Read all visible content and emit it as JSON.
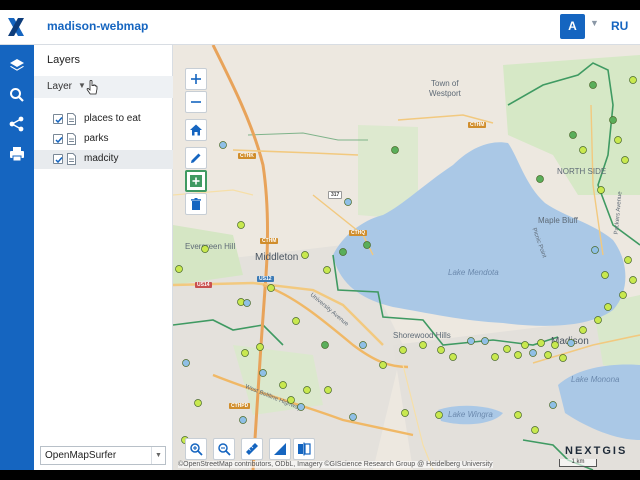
{
  "app": {
    "title": "madison-webmap",
    "user_initial": "A",
    "language": "RU"
  },
  "rail": {
    "icons": [
      "layers-icon",
      "search-icon",
      "share-icon",
      "print-icon"
    ]
  },
  "panel": {
    "title": "Layers",
    "column_header": "Layer",
    "layers": [
      {
        "label": "places to eat",
        "checked": true
      },
      {
        "label": "parks",
        "checked": true
      },
      {
        "label": "madcity",
        "checked": true
      }
    ],
    "basemap": "OpenMapSurfer"
  },
  "map": {
    "labels": {
      "town_of_westport": "Town of",
      "town_of_westport_2": "Westport",
      "north_side": "NORTH SIDE",
      "maple_bluff": "Maple Bluff",
      "middleton": "Middleton",
      "evergreen_hill": "Evergreen Hill",
      "lake_mendota": "Lake Mendota",
      "shorewood_hills": "Shorewood Hills",
      "madison": "Madison",
      "lake_monona": "Lake Monona",
      "lake_wingra": "Lake Wingra",
      "picnic_point": "Picnic Point",
      "packers_avenue": "Packers Avenue",
      "university_avenue": "University Avenue",
      "west_beltline": "West Beltline Highway"
    },
    "road_shields": {
      "ctm": "CTHM",
      "ctk": "CTHK",
      "ctq": "CTHQ",
      "cthm2": "CTHM",
      "us14": "US14",
      "us12": "US12",
      "hw317": "317",
      "cthpd": "CTHPD"
    },
    "attribution": "©OpenStreetMap contributors, ODbL, Imagery ©GIScience Research Group @ Heidelberg University",
    "scale": "1 km",
    "brand": "NEXTGIS",
    "colors": {
      "accent": "#1565c0",
      "lake": "#aac8e6",
      "park": "#c9e2b4",
      "boundary": "#3f9a62",
      "poi_yellow": "#c8e84f",
      "poi_blue": "#8fbfe6",
      "poi_green": "#5aae5a"
    }
  }
}
